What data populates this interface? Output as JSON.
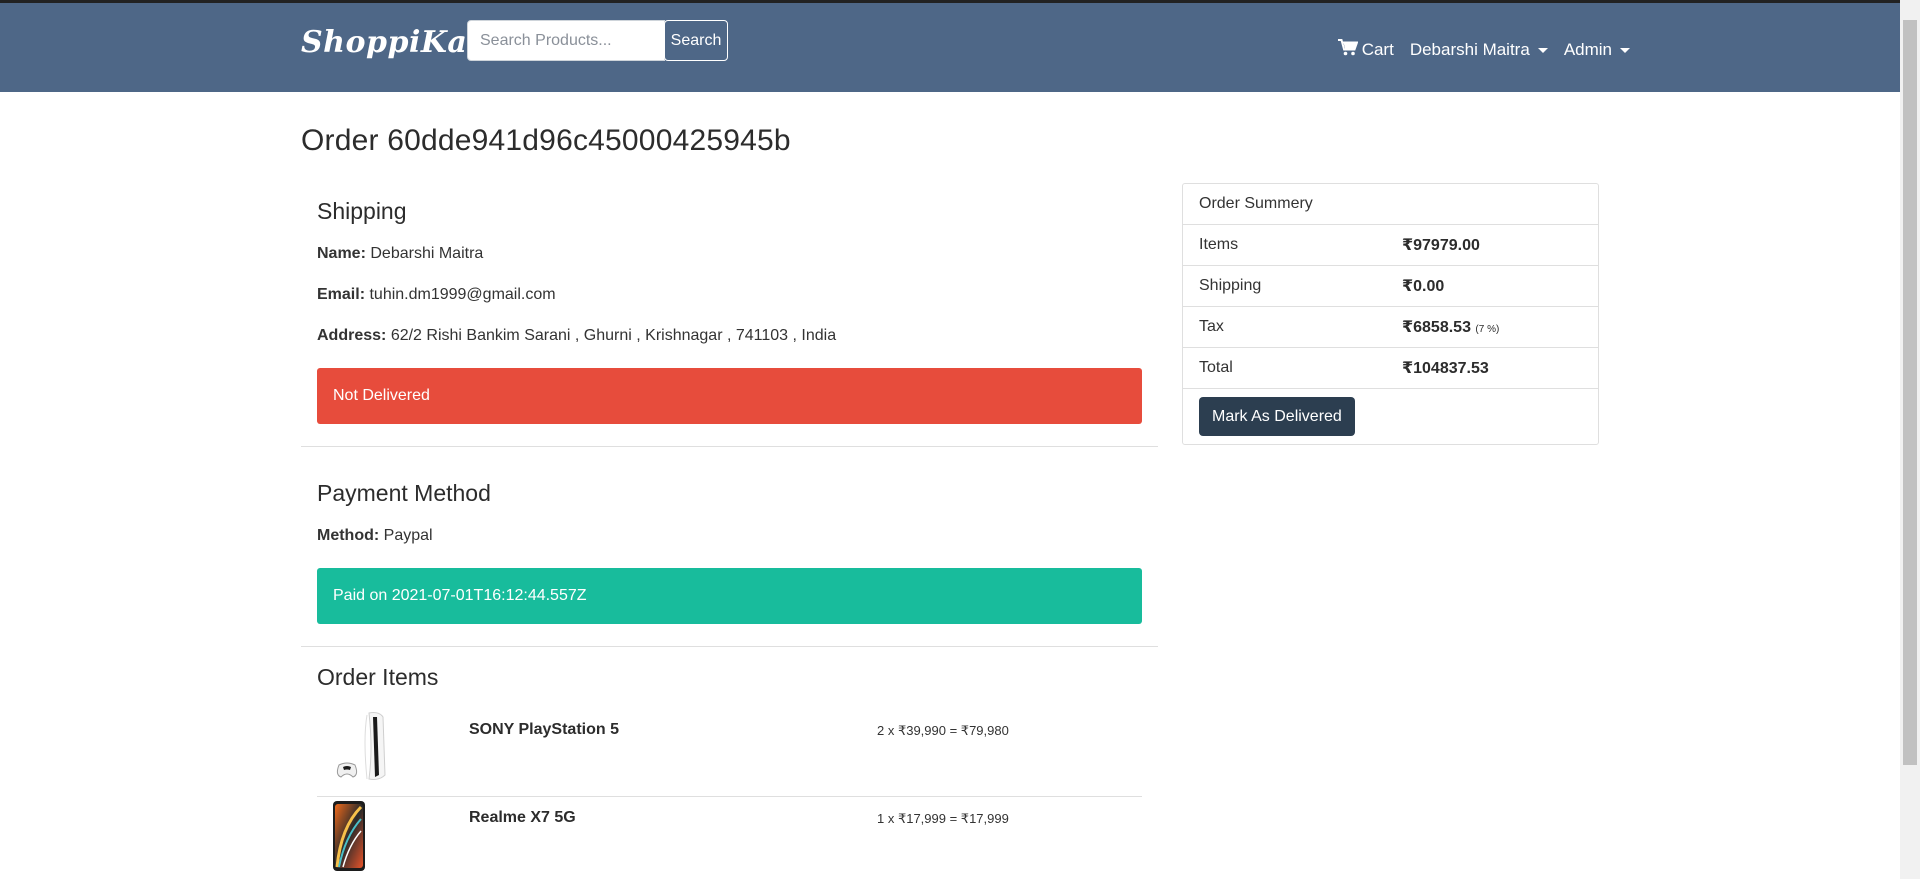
{
  "navbar": {
    "brand": "ShoppiKart",
    "search_placeholder": "Search Products...",
    "search_label": "Search",
    "cart_label": "Cart",
    "user_label": "Debarshi Maitra",
    "admin_label": "Admin",
    "bg_color": "#4e6787"
  },
  "page": {
    "title": "Order 60dde941d96c45000425945b"
  },
  "shipping": {
    "heading": "Shipping",
    "name_label": "Name:",
    "name_value": "Debarshi Maitra",
    "email_label": "Email:",
    "email_value": "tuhin.dm1999@gmail.com",
    "address_label": "Address:",
    "address_value": "62/2 Rishi Bankim Sarani , Ghurni , Krishnagar , 741103 , India",
    "status": "Not Delivered",
    "status_color": "#e74c3c"
  },
  "payment": {
    "heading": "Payment Method",
    "method_label": "Method:",
    "method_value": "Paypal",
    "status": "Paid on 2021-07-01T16:12:44.557Z",
    "status_color": "#18bc9c"
  },
  "order_items": {
    "heading": "Order Items",
    "items": [
      {
        "name": "SONY PlayStation 5",
        "price": "2 x ₹39,990 = ₹79,980",
        "image_icon": "playstation-5-image"
      },
      {
        "name": "Realme X7 5G",
        "price": "1 x ₹17,999 = ₹17,999",
        "image_icon": "smartphone-image"
      }
    ]
  },
  "summary": {
    "heading": "Order Summery",
    "rows": [
      {
        "label": "Items",
        "value": "₹97979.00",
        "note": ""
      },
      {
        "label": "Shipping",
        "value": "₹0.00",
        "note": ""
      },
      {
        "label": "Tax",
        "value": "₹6858.53",
        "note": "(7 %)"
      },
      {
        "label": "Total",
        "value": "₹104837.53",
        "note": ""
      }
    ],
    "button_label": "Mark As Delivered",
    "button_color": "#2c3e50"
  }
}
